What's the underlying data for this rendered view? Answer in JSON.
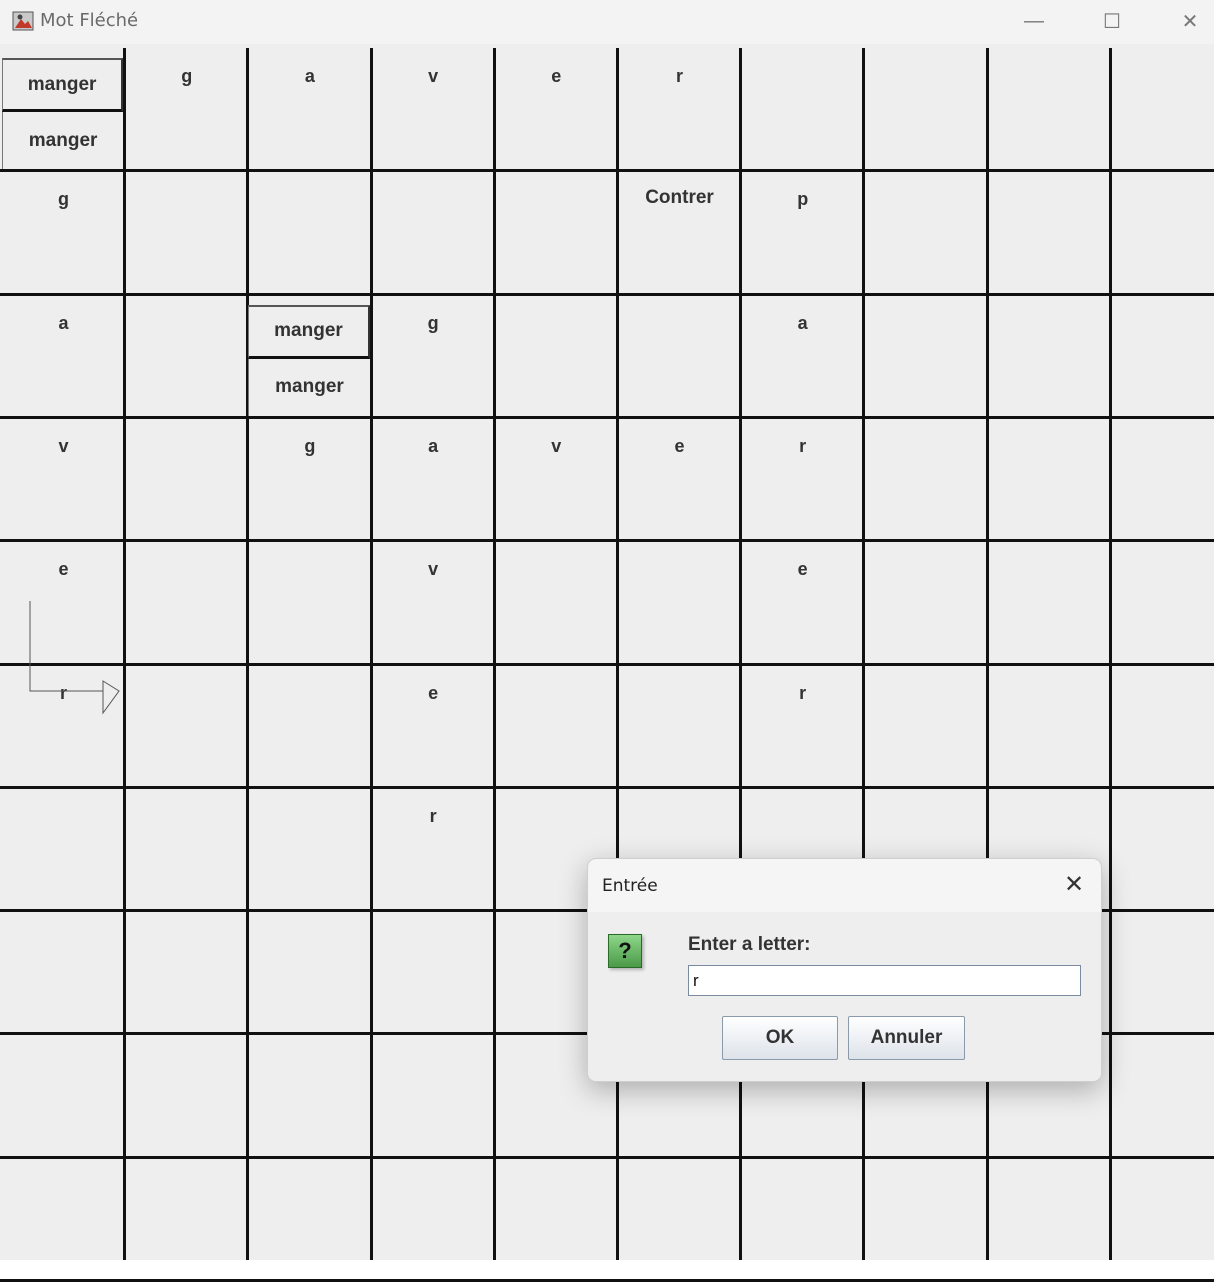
{
  "window": {
    "title": "Mot Fléché",
    "controls": {
      "minimize": "—",
      "maximize": "☐",
      "close": "✕"
    }
  },
  "grid": {
    "rows": 10,
    "cols": 10,
    "letters": [
      {
        "r": 0,
        "c": 1,
        "t": "g"
      },
      {
        "r": 0,
        "c": 2,
        "t": "a"
      },
      {
        "r": 0,
        "c": 3,
        "t": "v"
      },
      {
        "r": 0,
        "c": 4,
        "t": "e"
      },
      {
        "r": 0,
        "c": 5,
        "t": "r"
      },
      {
        "r": 1,
        "c": 0,
        "t": "g"
      },
      {
        "r": 1,
        "c": 6,
        "t": "p"
      },
      {
        "r": 2,
        "c": 0,
        "t": "a"
      },
      {
        "r": 2,
        "c": 3,
        "t": "g"
      },
      {
        "r": 2,
        "c": 6,
        "t": "a"
      },
      {
        "r": 3,
        "c": 0,
        "t": "v"
      },
      {
        "r": 3,
        "c": 2,
        "t": "g"
      },
      {
        "r": 3,
        "c": 3,
        "t": "a"
      },
      {
        "r": 3,
        "c": 4,
        "t": "v"
      },
      {
        "r": 3,
        "c": 5,
        "t": "e"
      },
      {
        "r": 3,
        "c": 6,
        "t": "r"
      },
      {
        "r": 4,
        "c": 0,
        "t": "e"
      },
      {
        "r": 4,
        "c": 3,
        "t": "v"
      },
      {
        "r": 4,
        "c": 6,
        "t": "e"
      },
      {
        "r": 5,
        "c": 0,
        "t": "r"
      },
      {
        "r": 5,
        "c": 3,
        "t": "e"
      },
      {
        "r": 5,
        "c": 6,
        "t": "r"
      },
      {
        "r": 6,
        "c": 3,
        "t": "r"
      }
    ],
    "clues": [
      {
        "r": 0,
        "c": 0,
        "items": [
          "manger",
          "manger"
        ]
      },
      {
        "r": 1,
        "c": 5,
        "items": [
          "Contrer"
        ]
      },
      {
        "r": 2,
        "c": 2,
        "items": [
          "manger",
          "manger"
        ]
      }
    ]
  },
  "dialog": {
    "title": "Entrée",
    "close": "✕",
    "icon": "question-icon",
    "icon_glyph": "?",
    "prompt": "Enter a letter:",
    "input_value": "r",
    "ok_label": "OK",
    "cancel_label": "Annuler"
  }
}
